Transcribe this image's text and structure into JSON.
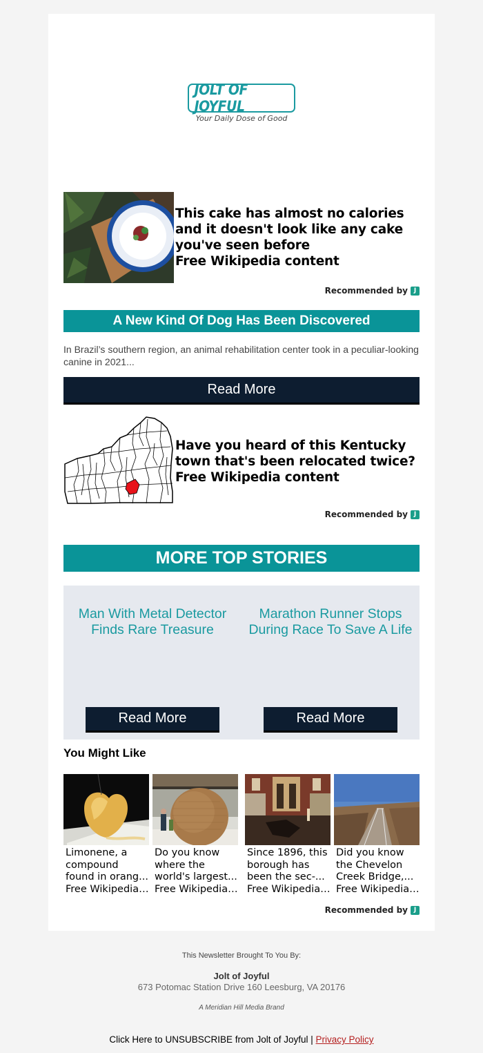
{
  "brand": {
    "logo_text": "JOLT OF JOYFUL",
    "tagline": "Your Daily Dose of Good",
    "primary_color": "#0a9498",
    "button_color": "#0d1d30"
  },
  "recommended_1": {
    "title": "This cake has almost no calories and it doesn't look like any cake you've seen before",
    "source": "Free Wikipedia content",
    "recommended_by": "Recommended by",
    "badge": "J"
  },
  "feature": {
    "title": "A New Kind Of Dog Has Been Discovered",
    "description": "In Brazil’s southern region, an animal rehabilitation center took in a peculiar-looking canine in 2021...",
    "button": "Read More"
  },
  "recommended_2": {
    "title": "Have you heard of this Kentucky town that's been relocated twice?",
    "source": "Free Wikipedia content",
    "recommended_by": "Recommended by",
    "badge": "J"
  },
  "more_top_stories": {
    "header": "MORE TOP STORIES",
    "stories": [
      {
        "title": "Man With Metal Detector Finds Rare Treasure",
        "button": "Read More"
      },
      {
        "title": "Marathon Runner Stops During Race To Save A Life",
        "button": "Read More"
      }
    ]
  },
  "you_might_like": {
    "header": "You Might Like",
    "tiles": [
      {
        "title": "Limonene, a compound found in orang...",
        "source": "Free Wikipedia ..."
      },
      {
        "title": "Do you know where the world's largest...",
        "source": "Free Wikipedia ..."
      },
      {
        "title": "Since 1896, this borough has been the sec-...",
        "source": "Free Wikipedia ..."
      },
      {
        "title": "Did you know the Chevelon Creek Bridge,...",
        "source": "Free Wikipedia ..."
      }
    ],
    "recommended_by": "Recommended by",
    "badge": "J"
  },
  "footer": {
    "brought_by": "This Newsletter Brought To You By:",
    "company": "Jolt of Joyful",
    "address": "673 Potomac Station Drive 160 Leesburg, VA 20176",
    "parent_brand": "A Meridian Hill Media Brand",
    "unsubscribe": "Click Here to UNSUBSCRIBE from Jolt of Joyful |",
    "privacy": "Privacy Policy"
  }
}
